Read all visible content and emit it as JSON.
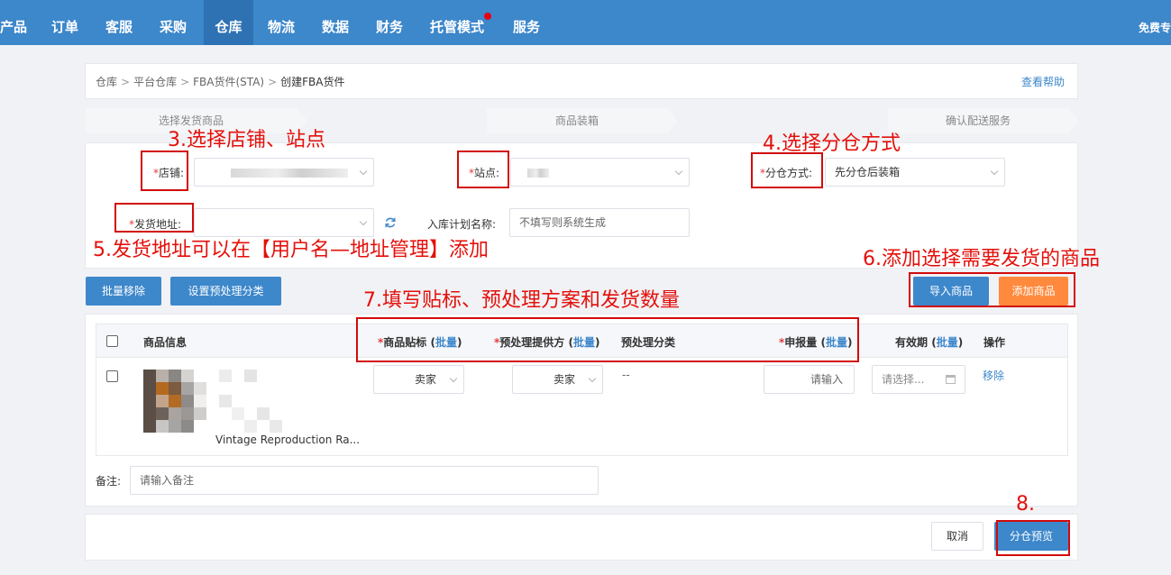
{
  "nav": {
    "items": [
      "产品",
      "订单",
      "客服",
      "采购",
      "仓库",
      "物流",
      "数据",
      "财务",
      "托管模式",
      "服务"
    ],
    "active_index": 4,
    "right_text": "免费专"
  },
  "breadcrumb": {
    "items": [
      "仓库",
      "平台仓库",
      "FBA货件(STA)",
      "创建FBA货件"
    ],
    "help": "查看帮助"
  },
  "steps": [
    "选择发货商品",
    "商品装箱",
    "确认配送服务"
  ],
  "form": {
    "store_label": "店铺",
    "site_label": "站点",
    "split_label": "分仓方式",
    "split_value": "先分仓后装箱",
    "address_label": "发货地址",
    "plan_label": "入库计划名称",
    "plan_placeholder": "不填写则系统生成",
    "refresh_icon": "refresh-icon"
  },
  "annotations": {
    "a3": "3.选择店铺、站点",
    "a4": "4.选择分仓方式",
    "a5": "5.发货地址可以在【用户名—地址管理】添加",
    "a6": "6.添加选择需要发货的商品",
    "a7": "7.填写贴标、预处理方案和发货数量",
    "a8": "8."
  },
  "toolbar": {
    "batch_remove": "批量移除",
    "set_prep": "设置预处理分类",
    "import": "导入商品",
    "add": "添加商品"
  },
  "table": {
    "headers": {
      "product_info": "商品信息",
      "label": "商品贴标",
      "prep_provider": "预处理提供方",
      "prep_category": "预处理分类",
      "declared_qty": "申报量",
      "expiry": "有效期",
      "action": "操作",
      "batch": "批量"
    },
    "row": {
      "product_name": "Vintage Reproduction Ra...",
      "label_value": "卖家",
      "prep_value": "卖家",
      "prep_category": "--",
      "qty_placeholder": "请输入",
      "expiry_placeholder": "请选择...",
      "remove": "移除"
    }
  },
  "remark": {
    "label": "备注:",
    "placeholder": "请输入备注"
  },
  "footer": {
    "cancel": "取消",
    "preview": "分仓预览"
  },
  "colors": {
    "nav_bg": "#3d87cb",
    "primary": "#3d87cb",
    "orange": "#ff8a3d",
    "annotation_red": "#e4100b"
  }
}
